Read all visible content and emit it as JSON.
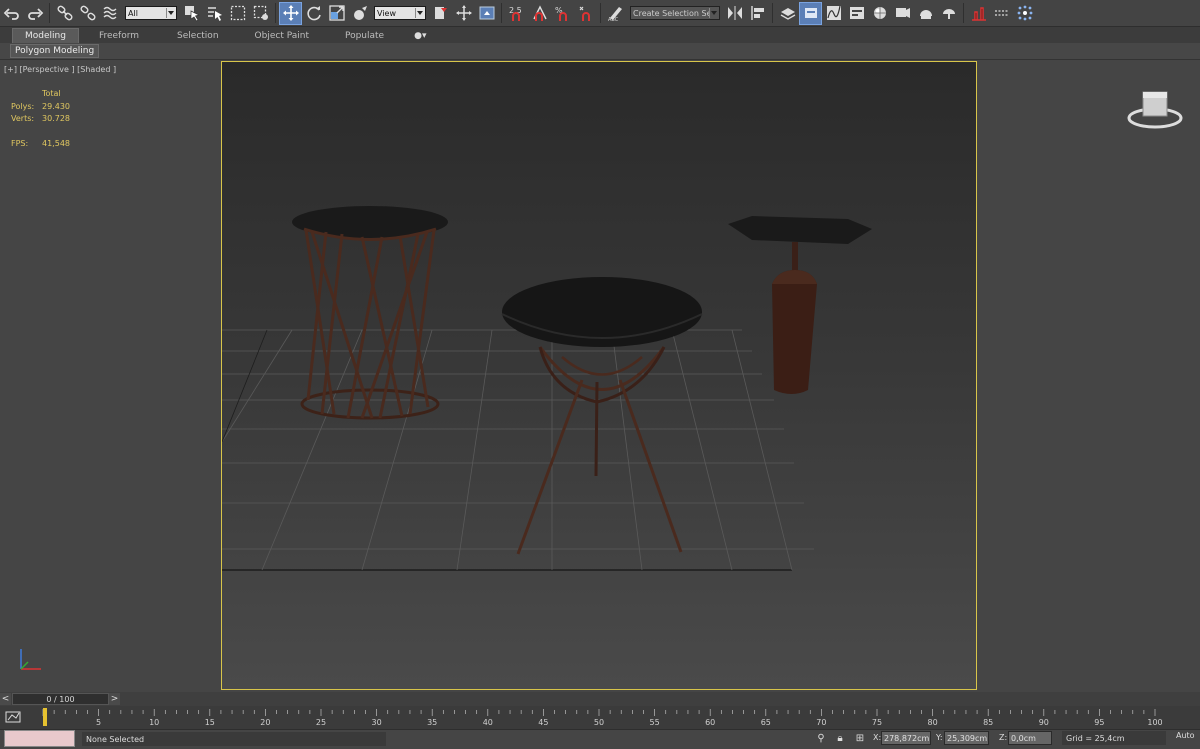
{
  "toolbar": {
    "selection_filter": "All",
    "ref_coord": "View",
    "snap_angle": "2.5",
    "selection_set_placeholder": "Create Selection Se",
    "icons": [
      "undo-icon",
      "redo-icon",
      "link-icon",
      "unlink-icon",
      "bind-space-warp-icon",
      "select-object-icon",
      "select-by-name-icon",
      "rect-selection-icon",
      "window-crossing-icon",
      "select-move-icon",
      "select-rotate-icon",
      "select-scale-icon",
      "select-place-icon",
      "use-pivot-icon",
      "select-manipulate-icon",
      "keyboard-shortcut-icon",
      "snaps-toggle-icon",
      "angle-snap-icon",
      "percent-snap-icon",
      "spinner-snap-icon",
      "edit-named-selection-icon",
      "mirror-icon",
      "align-icon",
      "toggle-scene-explorer-icon",
      "toggle-layer-explorer-icon",
      "curve-editor-icon",
      "schematic-view-icon",
      "material-editor-icon",
      "render-setup-icon",
      "rendered-frame-window-icon",
      "render-production-icon",
      "civil-view-icon",
      "grid-icon",
      "particle-icon"
    ]
  },
  "ribbon": {
    "tabs": [
      "Modeling",
      "Freeform",
      "Selection",
      "Object Paint",
      "Populate"
    ],
    "active_tab": "Modeling",
    "panel_label": "Polygon Modeling"
  },
  "viewport": {
    "label": "[+] [Perspective ] [Shaded ]",
    "stats_header": "Total",
    "polys_label": "Polys:",
    "polys_value": "29.430",
    "verts_label": "Verts:",
    "verts_value": "30.728",
    "fps_label": "FPS:",
    "fps_value": "41,548",
    "active_border_color": "#d8c54a"
  },
  "timeline": {
    "frame_display": "0 / 100",
    "prev_label": "<",
    "next_label": ">",
    "ticks": [
      "5",
      "10",
      "15",
      "20",
      "25",
      "30",
      "35",
      "40",
      "45",
      "50",
      "55",
      "60",
      "65",
      "70",
      "75",
      "80",
      "85",
      "90",
      "95",
      "100"
    ]
  },
  "status": {
    "selection": "None Selected",
    "x_label": "X:",
    "x_value": "278,872cm",
    "y_label": "Y:",
    "y_value": "25,309cm",
    "z_label": "Z:",
    "z_value": "0,0cm",
    "grid": "Grid = 25,4cm",
    "auto_key": "Auto"
  }
}
